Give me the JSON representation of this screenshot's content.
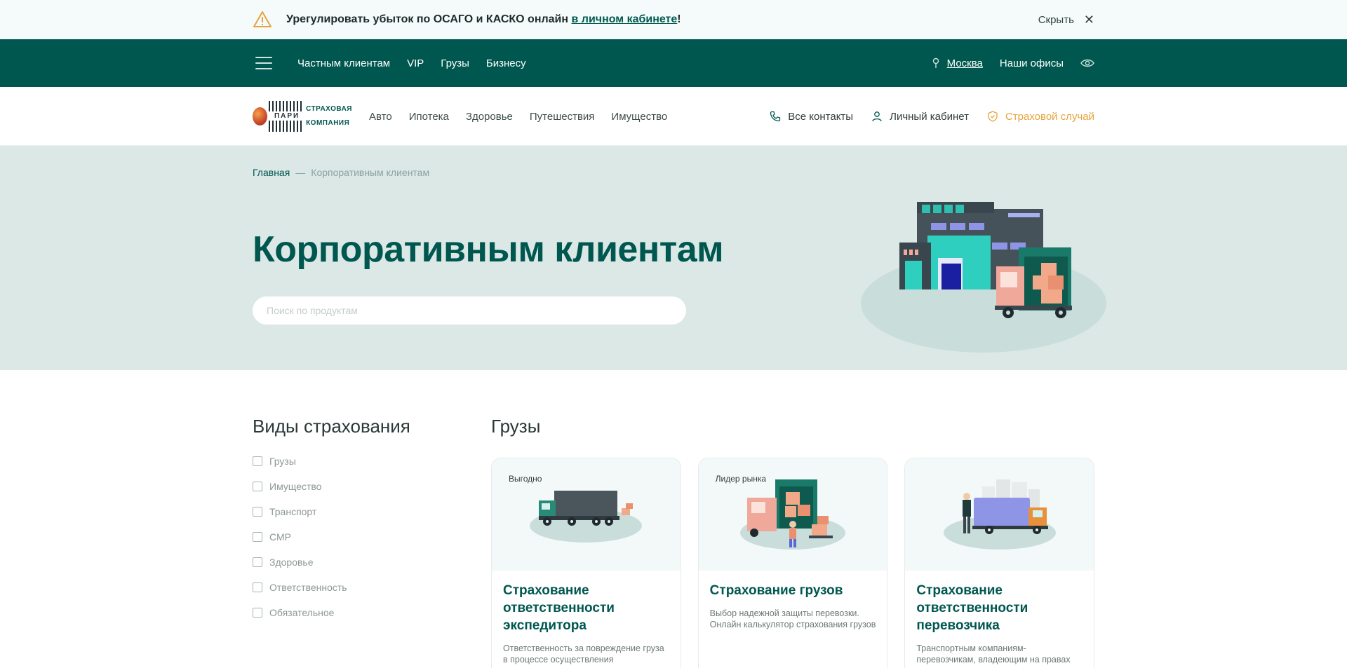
{
  "notice": {
    "message_prefix": "Урегулировать убыток по ОСАГО и КАСКО онлайн ",
    "message_link": "в личном кабинете",
    "message_suffix": "!",
    "hide_label": "Скрыть",
    "close_glyph": "✕",
    "icon": "warning-icon"
  },
  "topnav": {
    "links": [
      "Частным клиентам",
      "VIP",
      "Грузы",
      "Бизнесу"
    ],
    "city": "Москва",
    "offices": "Наши офисы"
  },
  "logo": {
    "brand": "ПАРИ",
    "line1": "СТРАХОВАЯ",
    "line2": "КОМПАНИЯ"
  },
  "mainnav": {
    "links": [
      "Авто",
      "Ипотека",
      "Здоровье",
      "Путешествия",
      "Имущество"
    ],
    "contacts": "Все контакты",
    "cabinet": "Личный кабинет",
    "claim": "Страховой случай"
  },
  "hero": {
    "breadcrumb_home": "Главная",
    "breadcrumb_sep": "—",
    "breadcrumb_current": "Корпоративным клиентам",
    "title": "Корпоративным клиентам",
    "search_placeholder": "Поиск по продуктам"
  },
  "sidebar": {
    "title": "Виды страхования",
    "filters": [
      "Грузы",
      "Имущество",
      "Транспорт",
      "СМР",
      "Здоровье",
      "Ответственность",
      "Обязательное"
    ]
  },
  "main": {
    "title": "Грузы",
    "cards": [
      {
        "badge": "Выгодно",
        "title": "Страхование ответственности экспедитора",
        "text": "Ответственность за повреждение груза в процессе осуществления"
      },
      {
        "badge": "Лидер рынка",
        "title": "Страхование грузов",
        "text": "Выбор надежной защиты перевозки. Онлайн калькулятор страхования грузов"
      },
      {
        "badge": "",
        "title": "Страхование ответственности перевозчика",
        "text": "Транспортным компаниям-перевозчикам, владеющим на правах"
      }
    ]
  },
  "colors": {
    "brand_green": "#00574f",
    "hero_bg": "#dbe8e6",
    "accent_orange": "#e8a33c"
  }
}
